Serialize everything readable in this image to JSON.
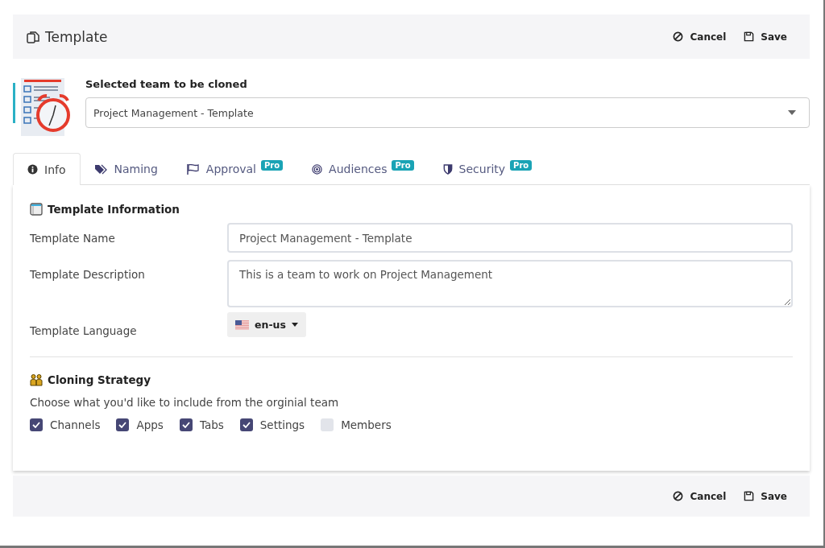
{
  "header": {
    "title": "Template",
    "buttons": [
      "Cancel",
      "Save"
    ]
  },
  "team": {
    "label": "Selected team to be cloned",
    "value": "Project Management - Template"
  },
  "tabs": [
    {
      "label": "Info",
      "selected": true
    },
    {
      "label": "Naming",
      "selected": false
    },
    {
      "label": "Approval",
      "selected": false,
      "badge": "Pro"
    },
    {
      "label": "Audiences",
      "selected": false,
      "badge": "Pro"
    },
    {
      "label": "Security",
      "selected": false,
      "badge": "Pro"
    }
  ],
  "info": {
    "title": "Template Information",
    "fields": [
      {
        "label": "Template Name",
        "kind": "input",
        "value": "Project Management - Template"
      },
      {
        "label": "Template Description",
        "kind": "textarea",
        "value": "This is a team to work on Project Management"
      },
      {
        "label": "Template Language",
        "kind": "language",
        "value": "en-us"
      }
    ]
  },
  "cloning": {
    "title": "Cloning Strategy",
    "description": "Choose what you'd like to include from the orginial team",
    "options": [
      {
        "label": "Channels",
        "checked": true
      },
      {
        "label": "Apps",
        "checked": true
      },
      {
        "label": "Tabs",
        "checked": true
      },
      {
        "label": "Settings",
        "checked": true
      },
      {
        "label": "Members",
        "checked": false
      }
    ]
  },
  "footer": {
    "buttons": [
      "Cancel",
      "Save"
    ]
  }
}
